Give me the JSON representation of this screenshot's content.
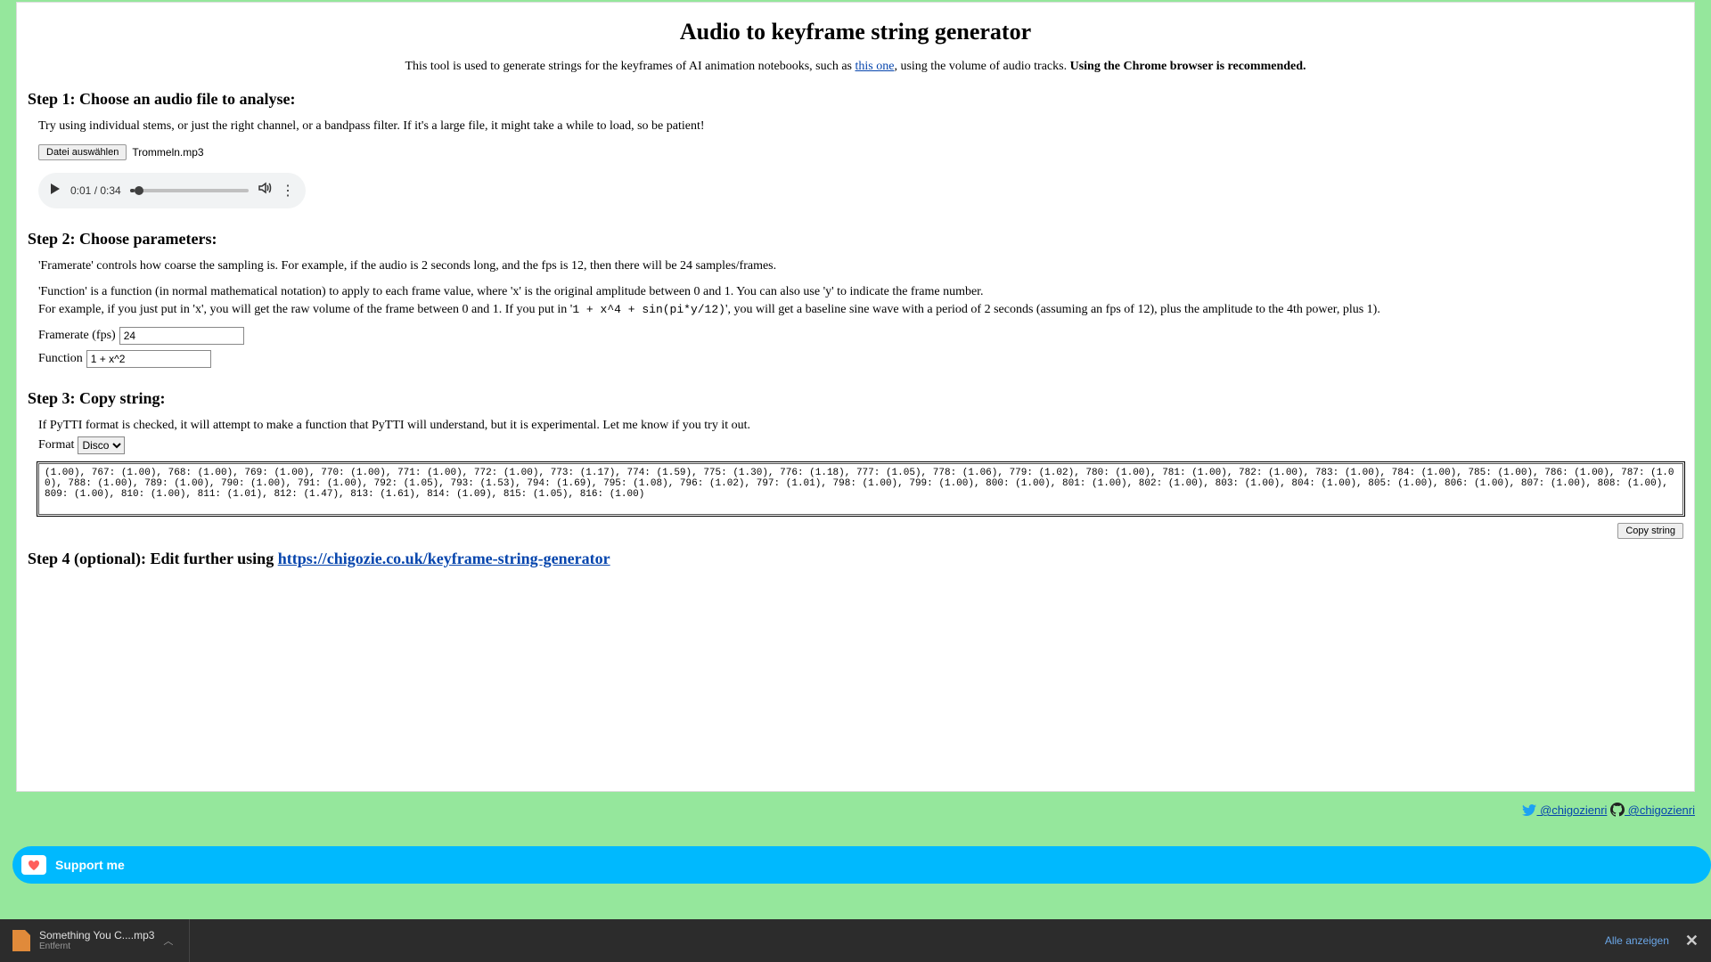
{
  "title": "Audio to keyframe string generator",
  "subtitle": {
    "pre": "This tool is used to generate strings for the keyframes of AI animation notebooks, such as ",
    "link": "this one",
    "mid": ", using the volume of audio tracks. ",
    "strong": "Using the Chrome browser is recommended."
  },
  "step1": {
    "heading": "Step 1: Choose an audio file to analyse:",
    "hint": "Try using individual stems, or just the right channel, or a bandpass filter. If it's a large file, it might take a while to load, so be patient!",
    "file_button": "Datei auswählen",
    "file_name": "Trommeln.mp3",
    "audio_time": "0:01 / 0:34"
  },
  "step2": {
    "heading": "Step 2: Choose parameters:",
    "framerate_desc": "'Framerate' controls how coarse the sampling is. For example, if the audio is 2 seconds long, and the fps is 12, then there will be 24 samples/frames.",
    "function_desc_pre": "'Function' is a function (in normal mathematical notation) to apply to each frame value, where 'x' is the original amplitude between 0 and 1. You can also use 'y' to indicate the frame number.",
    "function_desc_line2_pre": "For example, if you just put in 'x', you will get the raw volume of the frame between 0 and 1. If you put in '",
    "function_example": "1 + x^4 + sin(pi*y/12)",
    "function_desc_line2_post": "', you will get a baseline sine wave with a period of 2 seconds (assuming an fps of 12), plus the amplitude to the 4th power, plus 1).",
    "framerate_label": "Framerate (fps)",
    "framerate_value": "24",
    "function_label": "Function",
    "function_value": "1 + x^2"
  },
  "step3": {
    "heading": "Step 3: Copy string:",
    "pytti_note": "If PyTTI format is checked, it will attempt to make a function that PyTTI will understand, but it is experimental. Let me know if you try it out.",
    "format_label": "Format",
    "format_value": "Disco",
    "output": "(1.00), 767: (1.00), 768: (1.00), 769: (1.00), 770: (1.00), 771: (1.00), 772: (1.00), 773: (1.17), 774: (1.59), 775: (1.30), 776: (1.18), 777: (1.05), 778: (1.06), 779: (1.02), 780: (1.00), 781: (1.00), 782: (1.00), 783: (1.00), 784: (1.00), 785: (1.00), 786: (1.00), 787: (1.00), 788: (1.00), 789: (1.00), 790: (1.00), 791: (1.00), 792: (1.05), 793: (1.53), 794: (1.69), 795: (1.08), 796: (1.02), 797: (1.01), 798: (1.00), 799: (1.00), 800: (1.00), 801: (1.00), 802: (1.00), 803: (1.00), 804: (1.00), 805: (1.00), 806: (1.00), 807: (1.00), 808: (1.00), 809: (1.00), 810: (1.00), 811: (1.01), 812: (1.47), 813: (1.61), 814: (1.09), 815: (1.05), 816: (1.00)",
    "copy_button": "Copy string"
  },
  "step4": {
    "heading_pre": "Step 4 (optional): Edit further using ",
    "link": "https://chigozie.co.uk/keyframe-string-generator"
  },
  "footer": {
    "twitter": " @chigozienri",
    "github": " @chigozienri"
  },
  "support": {
    "label": "Support me"
  },
  "download_bar": {
    "file": "Something You C....mp3",
    "status": "Entfernt",
    "show_all": "Alle anzeigen"
  }
}
